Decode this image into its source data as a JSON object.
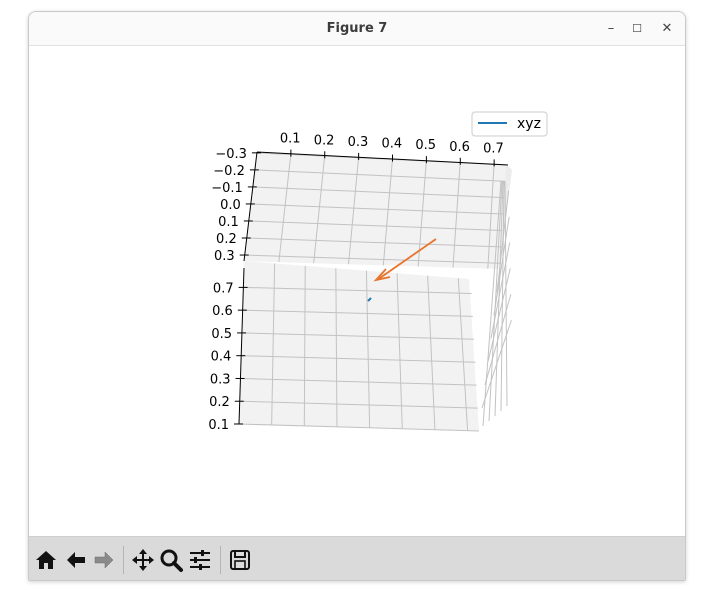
{
  "window": {
    "title": "Figure 7",
    "controls": {
      "minimize": "–",
      "maximize": "☐",
      "close": "✕"
    }
  },
  "toolbar": {
    "buttons": [
      {
        "name": "home-icon",
        "tooltip": "Home"
      },
      {
        "name": "back-arrow-icon",
        "tooltip": "Back"
      },
      {
        "name": "forward-arrow-icon",
        "tooltip": "Forward"
      },
      {
        "name": "pan-icon",
        "tooltip": "Pan"
      },
      {
        "name": "zoom-icon",
        "tooltip": "Zoom"
      },
      {
        "name": "configure-subplots-icon",
        "tooltip": "Subplots"
      },
      {
        "name": "save-icon",
        "tooltip": "Save"
      }
    ]
  },
  "chart_data": {
    "type": "line",
    "projection": "3d",
    "title": "",
    "legend": {
      "entries": [
        "xyz"
      ],
      "placement": "top-right"
    },
    "x_ticks": [
      "0.1",
      "0.2",
      "0.3",
      "0.4",
      "0.5",
      "0.6",
      "0.7"
    ],
    "y_ticks": [
      "−0.3",
      "−0.2",
      "−0.1",
      "0.0",
      "0.1",
      "0.2",
      "0.3"
    ],
    "z_ticks": [
      "0.7",
      "0.6",
      "0.5",
      "0.4",
      "0.3",
      "0.2",
      "0.1"
    ],
    "grid": true,
    "series": [
      {
        "name": "xyz",
        "color": "#1f77b4"
      }
    ],
    "arrow": {
      "color": "#e8742c"
    }
  }
}
